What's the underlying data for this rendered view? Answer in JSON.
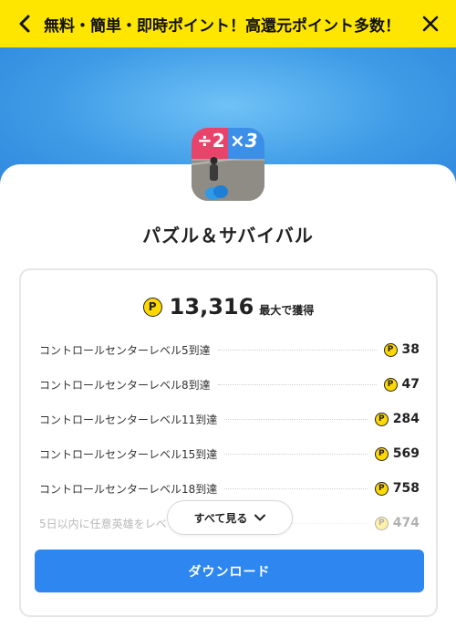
{
  "header": {
    "title": "無料・簡単・即時ポイント！高還元ポイント多数！"
  },
  "app": {
    "name": "パズル＆サバイバル",
    "icon_text_left": "÷2",
    "icon_text_right": "×3"
  },
  "rewards": {
    "coin_symbol": "P",
    "total_amount": "13,316",
    "total_suffix": "最大で獲得",
    "missions": [
      {
        "label": "コントロールセンターレベル5到達",
        "points": "38"
      },
      {
        "label": "コントロールセンターレベル8到達",
        "points": "47"
      },
      {
        "label": "コントロールセンターレベル11到達",
        "points": "284"
      },
      {
        "label": "コントロールセンターレベル15到達",
        "points": "569"
      },
      {
        "label": "コントロールセンターレベル18到達",
        "points": "758"
      },
      {
        "label": "5日以内に任意英雄をレベ",
        "points": "474"
      }
    ],
    "see_all_label": "すべて見る",
    "download_label": "ダウンロード"
  },
  "colors": {
    "topbar": "#ffe600",
    "accent": "#2e86f0",
    "coin": "#ffd800",
    "hero": "#3f9be6"
  },
  "icons": {
    "back": "chevron-left-icon",
    "close": "close-icon",
    "see_all": "chevron-down-icon",
    "coin": "point-coin-icon"
  }
}
